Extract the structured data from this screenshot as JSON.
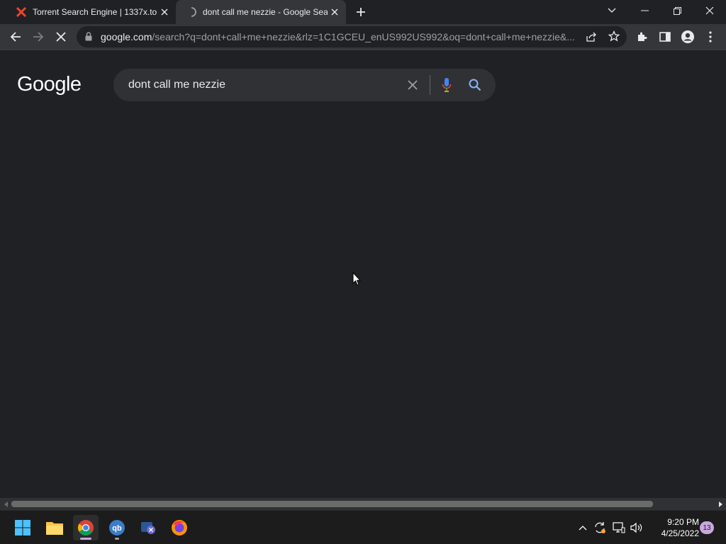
{
  "browser": {
    "tabs": [
      {
        "title": "Torrent Search Engine | 1337x.to",
        "favicon": "1337x-x-icon",
        "loading": false
      },
      {
        "title": "dont call me nezzie - Google Sea",
        "favicon": "loading-spinner-icon",
        "loading": true,
        "active": true
      }
    ],
    "address": {
      "host": "google.com",
      "path": "/search?q=dont+call+me+nezzie&rlz=1C1GCEU_enUS992US992&oq=dont+call+me+nezzie&..."
    }
  },
  "google": {
    "logo": "Google",
    "query": "dont call me nezzie"
  },
  "taskbar": {
    "apps": [
      "windows-start",
      "file-explorer",
      "chrome",
      "qbittorrent",
      "xbox-app",
      "firefox"
    ],
    "clock_time": "9:20 PM",
    "clock_date": "4/25/2022",
    "notification_count": "13"
  },
  "colors": {
    "page_bg": "#202124",
    "toolbar_bg": "#35363a",
    "searchbox_bg": "#303134",
    "accent_blue": "#8ab4f8",
    "tab_x_red": "#e8452c"
  }
}
